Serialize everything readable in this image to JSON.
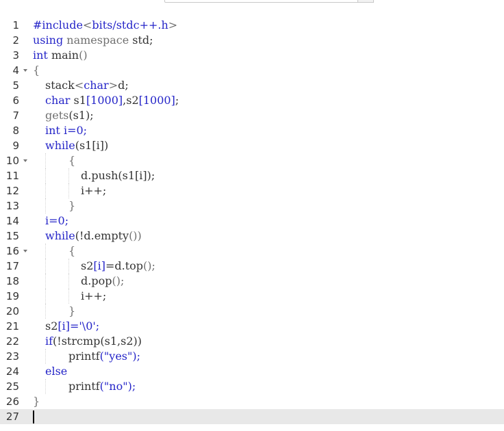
{
  "editor": {
    "lines": [
      {
        "n": "1",
        "fold": false,
        "indent": 0,
        "guides": [],
        "tokens": [
          {
            "t": "#include",
            "c": "pre"
          },
          {
            "t": "<",
            "c": "gray"
          },
          {
            "t": "bits/stdc++.h",
            "c": "pre"
          },
          {
            "t": ">",
            "c": "gray"
          }
        ]
      },
      {
        "n": "2",
        "fold": false,
        "indent": 0,
        "guides": [],
        "tokens": [
          {
            "t": "using",
            "c": "kw"
          },
          {
            "t": " namespace",
            "c": "gray"
          },
          {
            "t": " std;",
            "c": "plain"
          }
        ]
      },
      {
        "n": "3",
        "fold": false,
        "indent": 0,
        "guides": [],
        "tokens": [
          {
            "t": "int",
            "c": "kw"
          },
          {
            "t": " main",
            "c": "plain"
          },
          {
            "t": "()",
            "c": "gray"
          }
        ]
      },
      {
        "n": "4",
        "fold": true,
        "indent": 0,
        "guides": [],
        "tokens": [
          {
            "t": "{",
            "c": "gray"
          }
        ]
      },
      {
        "n": "5",
        "fold": false,
        "indent": 18,
        "guides": [],
        "tokens": [
          {
            "t": "stack",
            "c": "plain"
          },
          {
            "t": "<",
            "c": "gray"
          },
          {
            "t": "char",
            "c": "kw"
          },
          {
            "t": ">",
            "c": "gray"
          },
          {
            "t": "d;",
            "c": "plain"
          }
        ]
      },
      {
        "n": "6",
        "fold": false,
        "indent": 18,
        "guides": [],
        "tokens": [
          {
            "t": "char",
            "c": "kw"
          },
          {
            "t": " s1",
            "c": "plain"
          },
          {
            "t": "[1000]",
            "c": "num"
          },
          {
            "t": ",s2",
            "c": "plain"
          },
          {
            "t": "[1000]",
            "c": "num"
          },
          {
            "t": ";",
            "c": "plain"
          }
        ]
      },
      {
        "n": "7",
        "fold": false,
        "indent": 18,
        "guides": [],
        "tokens": [
          {
            "t": "gets",
            "c": "gray"
          },
          {
            "t": "(s1);",
            "c": "plain"
          }
        ]
      },
      {
        "n": "8",
        "fold": false,
        "indent": 18,
        "guides": [],
        "tokens": [
          {
            "t": "int",
            "c": "kw"
          },
          {
            "t": " i=0;",
            "c": "num"
          }
        ]
      },
      {
        "n": "9",
        "fold": false,
        "indent": 18,
        "guides": [],
        "tokens": [
          {
            "t": "while",
            "c": "kw"
          },
          {
            "t": "(s1[i])",
            "c": "plain"
          }
        ]
      },
      {
        "n": "10",
        "fold": true,
        "indent": 52,
        "guides": [
          18
        ],
        "tokens": [
          {
            "t": "{",
            "c": "gray"
          }
        ]
      },
      {
        "n": "11",
        "fold": false,
        "indent": 70,
        "guides": [
          18,
          52
        ],
        "tokens": [
          {
            "t": "d.push",
            "c": "plain"
          },
          {
            "t": "(s1[i]);",
            "c": "plain"
          }
        ]
      },
      {
        "n": "12",
        "fold": false,
        "indent": 70,
        "guides": [
          18,
          52
        ],
        "tokens": [
          {
            "t": "i++;",
            "c": "plain"
          }
        ]
      },
      {
        "n": "13",
        "fold": false,
        "indent": 52,
        "guides": [
          18
        ],
        "tokens": [
          {
            "t": "}",
            "c": "gray"
          }
        ]
      },
      {
        "n": "14",
        "fold": false,
        "indent": 18,
        "guides": [],
        "tokens": [
          {
            "t": "i=0;",
            "c": "num"
          }
        ]
      },
      {
        "n": "15",
        "fold": false,
        "indent": 18,
        "guides": [],
        "tokens": [
          {
            "t": "while",
            "c": "kw"
          },
          {
            "t": "(!d.empty",
            "c": "plain"
          },
          {
            "t": "())",
            "c": "gray"
          }
        ]
      },
      {
        "n": "16",
        "fold": true,
        "indent": 52,
        "guides": [
          18
        ],
        "tokens": [
          {
            "t": "{",
            "c": "gray"
          }
        ]
      },
      {
        "n": "17",
        "fold": false,
        "indent": 70,
        "guides": [
          18,
          52
        ],
        "tokens": [
          {
            "t": "s2",
            "c": "plain"
          },
          {
            "t": "[i]",
            "c": "num"
          },
          {
            "t": "=d.top",
            "c": "plain"
          },
          {
            "t": "();",
            "c": "gray"
          }
        ]
      },
      {
        "n": "18",
        "fold": false,
        "indent": 70,
        "guides": [
          18,
          52
        ],
        "tokens": [
          {
            "t": "d.pop",
            "c": "plain"
          },
          {
            "t": "();",
            "c": "gray"
          }
        ]
      },
      {
        "n": "19",
        "fold": false,
        "indent": 70,
        "guides": [
          18,
          52
        ],
        "tokens": [
          {
            "t": "i++;",
            "c": "plain"
          }
        ]
      },
      {
        "n": "20",
        "fold": false,
        "indent": 52,
        "guides": [
          18
        ],
        "tokens": [
          {
            "t": "}",
            "c": "gray"
          }
        ]
      },
      {
        "n": "21",
        "fold": false,
        "indent": 18,
        "guides": [],
        "tokens": [
          {
            "t": "s2",
            "c": "plain"
          },
          {
            "t": "[i]",
            "c": "num"
          },
          {
            "t": "='\\0';",
            "c": "str"
          }
        ]
      },
      {
        "n": "22",
        "fold": false,
        "indent": 18,
        "guides": [],
        "tokens": [
          {
            "t": "if",
            "c": "kw"
          },
          {
            "t": "(!strcmp",
            "c": "plain"
          },
          {
            "t": "(s1,s2))",
            "c": "plain"
          }
        ]
      },
      {
        "n": "23",
        "fold": false,
        "indent": 52,
        "guides": [
          18
        ],
        "tokens": [
          {
            "t": "printf",
            "c": "plain"
          },
          {
            "t": "(\"yes\");",
            "c": "str"
          }
        ]
      },
      {
        "n": "24",
        "fold": false,
        "indent": 18,
        "guides": [],
        "tokens": [
          {
            "t": "else",
            "c": "kw"
          }
        ]
      },
      {
        "n": "25",
        "fold": false,
        "indent": 52,
        "guides": [
          18
        ],
        "tokens": [
          {
            "t": "printf",
            "c": "plain"
          },
          {
            "t": "(\"no\");",
            "c": "str"
          }
        ]
      },
      {
        "n": "26",
        "fold": false,
        "indent": 0,
        "guides": [],
        "tokens": [
          {
            "t": "}",
            "c": "gray"
          }
        ]
      },
      {
        "n": "27",
        "fold": false,
        "indent": 0,
        "guides": [],
        "active": true,
        "tokens": []
      }
    ]
  }
}
